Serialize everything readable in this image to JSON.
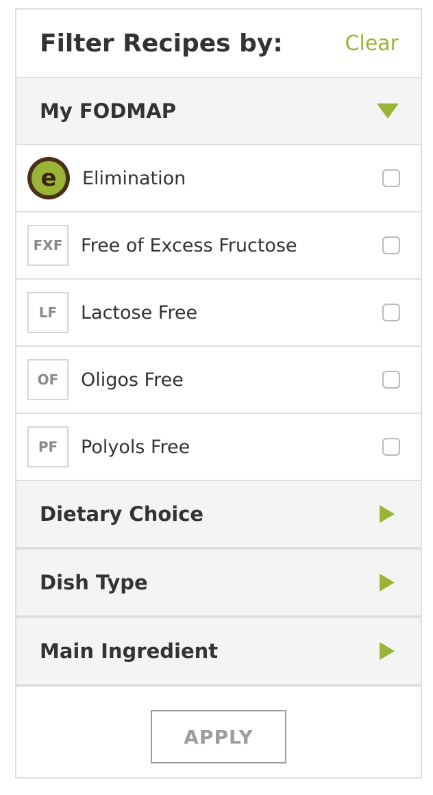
{
  "header": {
    "title": "Filter Recipes by:",
    "clear_label": "Clear"
  },
  "sections": {
    "my_fodmap": {
      "title": "My FODMAP",
      "icon": "triangle-down-icon"
    },
    "dietary_choice": {
      "title": "Dietary Choice",
      "icon": "triangle-right-icon"
    },
    "dish_type": {
      "title": "Dish Type",
      "icon": "triangle-right-icon"
    },
    "main_ingredient": {
      "title": "Main Ingredient",
      "icon": "triangle-right-icon"
    }
  },
  "options": [
    {
      "badge": "e",
      "label": "Elimination",
      "checked": false
    },
    {
      "badge": "FXF",
      "label": "Free of Excess Fructose",
      "checked": false
    },
    {
      "badge": "LF",
      "label": "Lactose Free",
      "checked": false
    },
    {
      "badge": "OF",
      "label": "Oligos Free",
      "checked": false
    },
    {
      "badge": "PF",
      "label": "Polyols Free",
      "checked": false
    }
  ],
  "footer": {
    "apply_label": "APPLY"
  },
  "colors": {
    "accent": "#9ab436",
    "border": "#dedede",
    "section_bg": "#f4f4f4"
  }
}
